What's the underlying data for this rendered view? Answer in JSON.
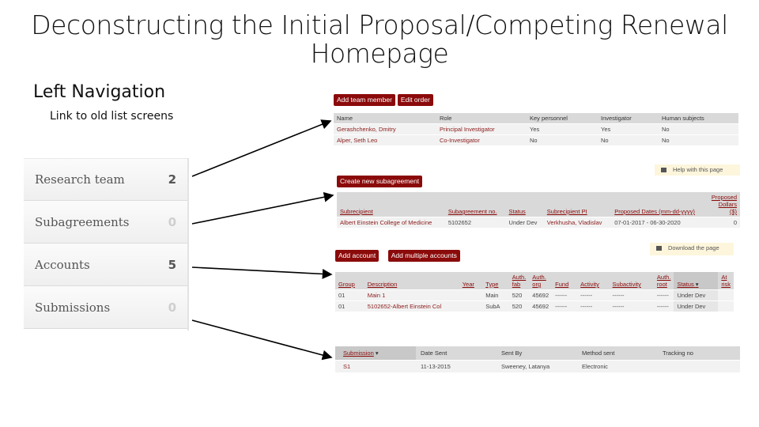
{
  "slide": {
    "title_line1": "Deconstructing the Initial Proposal/Competing Renewal",
    "title_line2": "Homepage",
    "heading": "Left Navigation",
    "subheading": "Link to old list screens"
  },
  "left_nav": {
    "items": [
      {
        "label": "Research team",
        "count": "2"
      },
      {
        "label": "Subagreements",
        "count": "0"
      },
      {
        "label": "Accounts",
        "count": "5"
      },
      {
        "label": "Submissions",
        "count": "0"
      }
    ]
  },
  "research_team": {
    "buttons": [
      "Add team member",
      "Edit order"
    ],
    "columns": [
      "Name",
      "Role",
      "Key personnel",
      "Investigator",
      "Human subjects"
    ],
    "rows": [
      [
        "Gerashchenko, Dmitry",
        "Principal Investigator",
        "Yes",
        "Yes",
        "No"
      ],
      [
        "Alper, Seth Leo",
        "Co-Investigator",
        "No",
        "No",
        "No"
      ]
    ]
  },
  "subagreements": {
    "button": "Create new subagreement",
    "help_text": "Help with this page",
    "columns": [
      "Subrecipient",
      "Subagreement no.",
      "Status",
      "Subrecipient PI",
      "Proposed Dates (mm-dd-yyyy)",
      "Proposed Dollars ($)"
    ],
    "rows": [
      [
        "Albert Einstein College of Medicine",
        "5102652",
        "Under Dev",
        "Verkhusha, Vladislav",
        "07-01-2017 - 06-30-2020",
        "0"
      ]
    ]
  },
  "accounts": {
    "buttons": [
      "Add account",
      "Add multiple accounts"
    ],
    "download_text": "Download the page",
    "columns": [
      "Group",
      "Description",
      "Year",
      "Type",
      "Auth. fab",
      "Auth. org",
      "Fund",
      "Activity",
      "Subactivity",
      "Auth. root",
      "Status",
      "At risk"
    ],
    "rows": [
      [
        "01",
        "Main 1",
        "",
        "Main",
        "520",
        "45692",
        "------",
        "------",
        "------",
        "------",
        "Under Dev",
        ""
      ],
      [
        "01",
        "5102652-Albert Einstein Col",
        "",
        "SubA",
        "520",
        "45692",
        "------",
        "------",
        "------",
        "------",
        "Under Dev",
        ""
      ]
    ]
  },
  "submissions": {
    "columns": [
      "Submission",
      "Date Sent",
      "Sent By",
      "Method sent",
      "Tracking no"
    ],
    "rows": [
      [
        "S1",
        "11-13-2015",
        "Sweeney, Latanya",
        "Electronic",
        ""
      ]
    ]
  }
}
